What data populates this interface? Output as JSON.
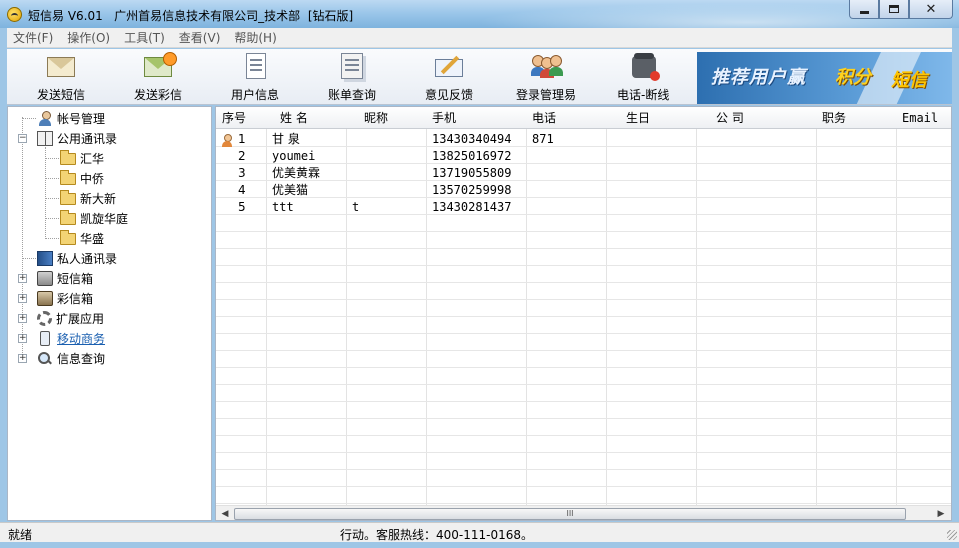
{
  "window": {
    "title": "短信易 V6.01   广州首易信息技术有限公司_技术部  [钻石版]"
  },
  "menu": [
    "文件(F)",
    "操作(O)",
    "工具(T)",
    "查看(V)",
    "帮助(H)"
  ],
  "toolbar": {
    "buttons": [
      {
        "label": "发送短信",
        "icon": "envelope-icon"
      },
      {
        "label": "发送彩信",
        "icon": "mms-envelope-icon"
      },
      {
        "label": "用户信息",
        "icon": "user-info-icon"
      },
      {
        "label": "账单查询",
        "icon": "bill-query-icon"
      },
      {
        "label": "意见反馈",
        "icon": "feedback-icon"
      },
      {
        "label": "登录管理易",
        "icon": "users-group-icon"
      },
      {
        "label": "电话-断线",
        "icon": "telephone-icon"
      }
    ],
    "banner": {
      "part1": "推荐用户赢",
      "part2": "积分",
      "part3": "短信"
    }
  },
  "tree": {
    "items": [
      {
        "label": "帐号管理",
        "icon": "person-icon"
      },
      {
        "label": "公用通讯录",
        "icon": "address-book-icon",
        "expanded": true,
        "children": [
          "汇华",
          "中侨",
          "新大新",
          "凯旋华庭",
          "华盛"
        ]
      },
      {
        "label": "私人通讯录",
        "icon": "phonebook-icon"
      },
      {
        "label": "短信箱",
        "icon": "inbox-icon"
      },
      {
        "label": "彩信箱",
        "icon": "mms-box-icon"
      },
      {
        "label": "扩展应用",
        "icon": "gear-icon"
      },
      {
        "label": "移动商务",
        "icon": "mobile-icon"
      },
      {
        "label": "信息查询",
        "icon": "search-icon"
      }
    ]
  },
  "grid": {
    "columns": [
      "序号",
      "姓 名",
      "昵称",
      "手机",
      "电话",
      "生日",
      "公 司",
      "职务",
      "Email"
    ],
    "rows": [
      [
        "1",
        "甘 泉",
        "",
        "13430340494",
        "871",
        "",
        "",
        "",
        ""
      ],
      [
        "2",
        "youmei",
        "",
        "13825016972",
        "",
        "",
        "",
        "",
        ""
      ],
      [
        "3",
        "优美黄霖",
        "",
        "13719055809",
        "",
        "",
        "",
        "",
        ""
      ],
      [
        "4",
        "优美猫",
        "",
        "13570259998",
        "",
        "",
        "",
        "",
        ""
      ],
      [
        "5",
        "ttt",
        "t",
        "13430281437",
        "",
        "",
        "",
        "",
        ""
      ]
    ],
    "scroll_grip": "III"
  },
  "status": {
    "left": "就绪",
    "center": "行动。客服热线：400-111-0168。"
  }
}
